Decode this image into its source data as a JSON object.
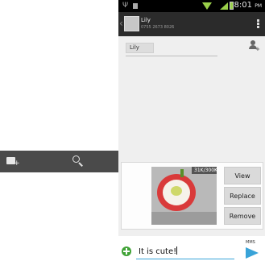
{
  "left_toolbar": {
    "compose_icon": "compose-icon",
    "search_icon": "search-icon"
  },
  "status_bar": {
    "time": "8:01",
    "ampm": "PM",
    "icons": [
      "usb-icon",
      "sd-card-icon",
      "wifi-icon",
      "signal-icon",
      "battery-icon"
    ]
  },
  "conversation": {
    "contact_name": "Lily",
    "contact_number": "0755 2673 8026",
    "overflow_icon": "overflow-menu-icon"
  },
  "recipients": {
    "chip_label": "Lily",
    "add_contact_icon": "add-contact-icon"
  },
  "attachment": {
    "size_badge": "31K/300K",
    "buttons": {
      "view": "View",
      "replace": "Replace",
      "remove": "Remove"
    }
  },
  "composer": {
    "message_text": "It is cute!",
    "mms_label": "MMS",
    "send_icon": "send-icon",
    "add_icon": "add-attachment-icon"
  },
  "colors": {
    "accent": "#39a3d8",
    "add_green": "#3fa235",
    "status_green": "#9ad04a",
    "toolbar_dark": "#4a4a4a"
  }
}
